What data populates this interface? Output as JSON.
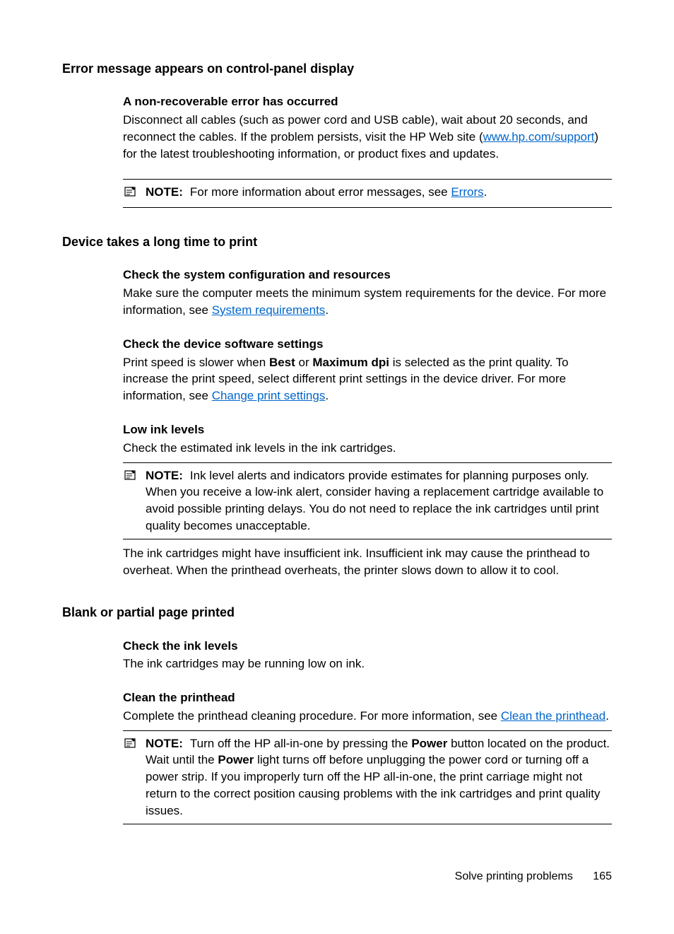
{
  "section1": {
    "heading": "Error message appears on control-panel display",
    "block1": {
      "subheading": "A non-recoverable error has occurred",
      "text1": "Disconnect all cables (such as power cord and USB cable), wait about 20 seconds, and reconnect the cables. If the problem persists, visit the HP Web site (",
      "link1": "www.hp.com/support",
      "text2": ") for the latest troubleshooting information, or product fixes and updates."
    },
    "note": {
      "label": "NOTE:",
      "text1": "For more information about error messages, see ",
      "link": "Errors",
      "text2": "."
    }
  },
  "section2": {
    "heading": "Device takes a long time to print",
    "block1": {
      "subheading": "Check the system configuration and resources",
      "text1": "Make sure the computer meets the minimum system requirements for the device. For more information, see ",
      "link": "System requirements",
      "text2": "."
    },
    "block2": {
      "subheading": "Check the device software settings",
      "text1": "Print speed is slower when ",
      "bold1": "Best",
      "text2": " or ",
      "bold2": "Maximum dpi",
      "text3": " is selected as the print quality. To increase the print speed, select different print settings in the device driver. For more information, see ",
      "link": "Change print settings",
      "text4": "."
    },
    "block3": {
      "subheading": "Low ink levels",
      "text": "Check the estimated ink levels in the ink cartridges."
    },
    "note": {
      "label": "NOTE:",
      "text": "Ink level alerts and indicators provide estimates for planning purposes only. When you receive a low-ink alert, consider having a replacement cartridge available to avoid possible printing delays. You do not need to replace the ink cartridges until print quality becomes unacceptable."
    },
    "afternote": "The ink cartridges might have insufficient ink. Insufficient ink may cause the printhead to overheat. When the printhead overheats, the printer slows down to allow it to cool."
  },
  "section3": {
    "heading": "Blank or partial page printed",
    "block1": {
      "subheading": "Check the ink levels",
      "text": "The ink cartridges may be running low on ink."
    },
    "block2": {
      "subheading": "Clean the printhead",
      "text1": "Complete the printhead cleaning procedure. For more information, see ",
      "link": "Clean the printhead",
      "text2": "."
    },
    "note": {
      "label": "NOTE:",
      "text1": "Turn off the HP all-in-one by pressing the ",
      "bold1": "Power",
      "text2": " button located on the product. Wait until the ",
      "bold2": "Power",
      "text3": " light turns off before unplugging the power cord or turning off a power strip. If you improperly turn off the HP all-in-one, the print carriage might not return to the correct position causing problems with the ink cartridges and print quality issues."
    }
  },
  "footer": {
    "text": "Solve printing problems",
    "page": "165"
  }
}
